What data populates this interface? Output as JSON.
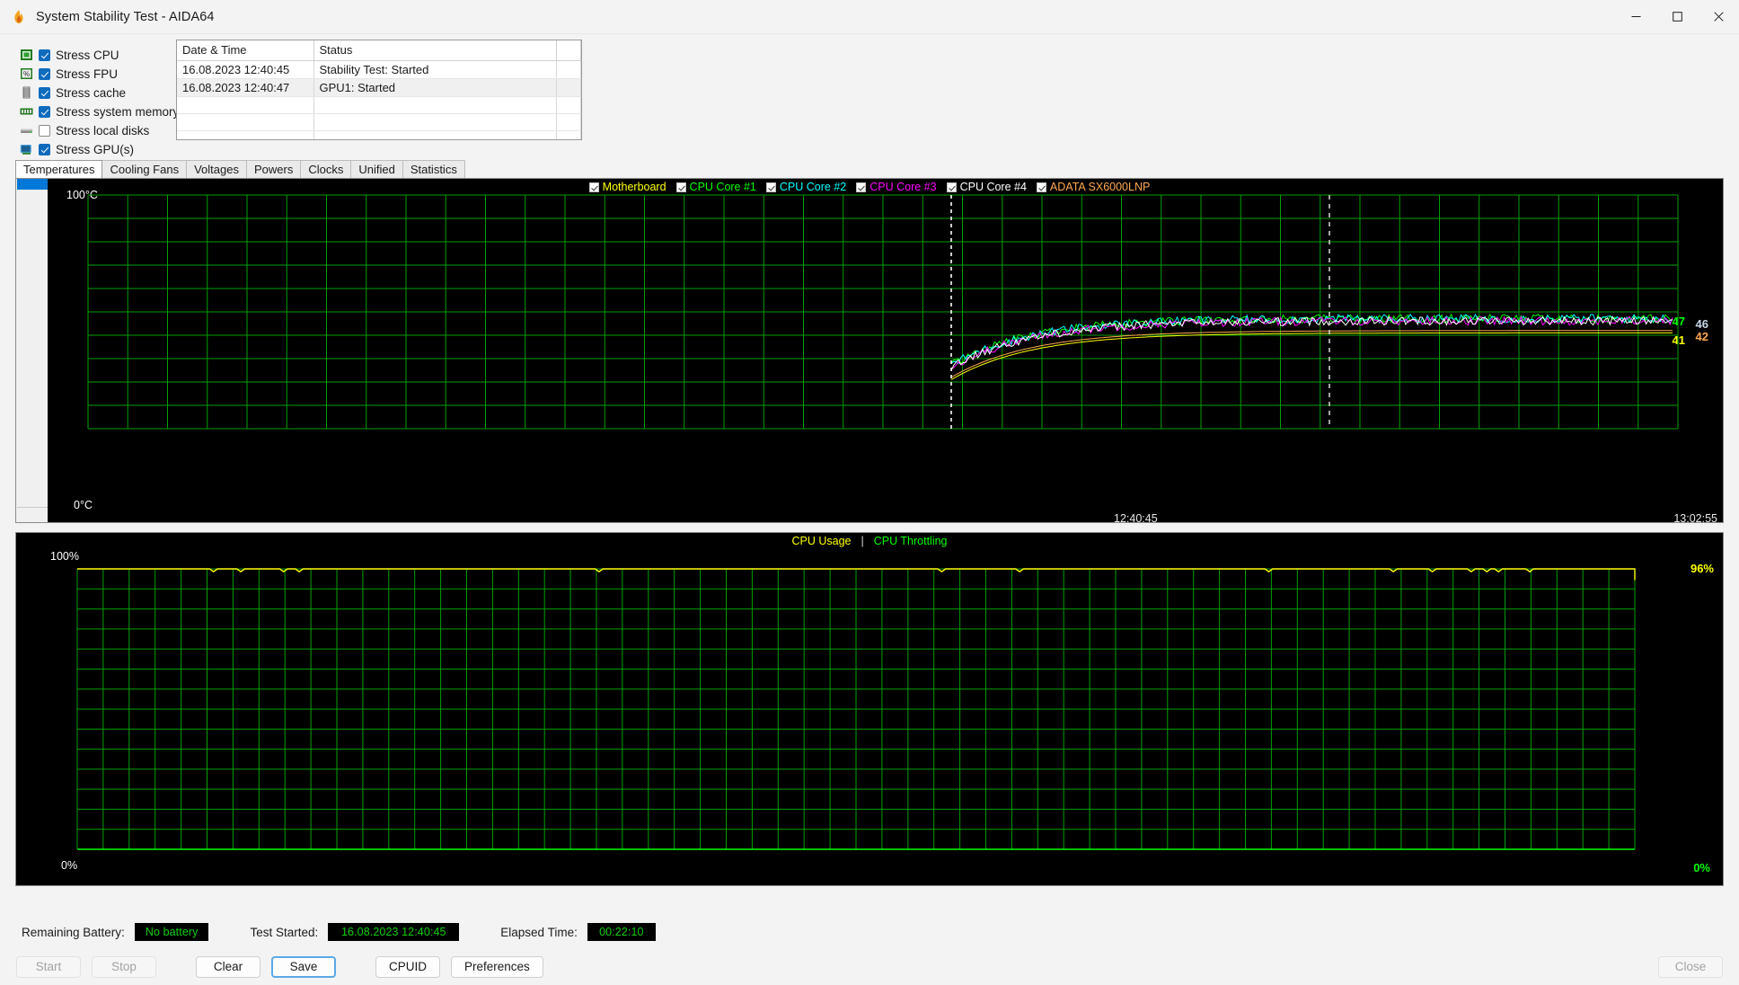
{
  "window": {
    "title": "System Stability Test - AIDA64",
    "icon": "aida64-flame-icon",
    "controls": {
      "minimize": "─",
      "maximize": "□",
      "close": "✕"
    }
  },
  "stress_options": [
    {
      "label": "Stress CPU",
      "checked": true,
      "icon": "cpu-chip-icon"
    },
    {
      "label": "Stress FPU",
      "checked": true,
      "icon": "fpu-percent-icon"
    },
    {
      "label": "Stress cache",
      "checked": true,
      "icon": "cache-icon"
    },
    {
      "label": "Stress system memory",
      "checked": true,
      "icon": "memory-module-icon"
    },
    {
      "label": "Stress local disks",
      "checked": false,
      "icon": "hard-disk-icon"
    },
    {
      "label": "Stress GPU(s)",
      "checked": true,
      "icon": "gpu-monitor-icon"
    }
  ],
  "log": {
    "columns": [
      "Date & Time",
      "Status"
    ],
    "rows": [
      {
        "datetime": "16.08.2023 12:40:45",
        "status": "Stability Test: Started"
      },
      {
        "datetime": "16.08.2023 12:40:47",
        "status": "GPU1: Started"
      }
    ]
  },
  "tabs": [
    {
      "label": "Temperatures",
      "active": true
    },
    {
      "label": "Cooling Fans",
      "active": false
    },
    {
      "label": "Voltages",
      "active": false
    },
    {
      "label": "Powers",
      "active": false
    },
    {
      "label": "Clocks",
      "active": false
    },
    {
      "label": "Unified",
      "active": false
    },
    {
      "label": "Statistics",
      "active": false
    }
  ],
  "chart_data": [
    {
      "type": "line",
      "name": "temperatures-chart",
      "title": "Temperatures",
      "ylabel_top": "100°C",
      "ylabel_bottom": "0°C",
      "ylim": [
        0,
        100
      ],
      "grid": true,
      "legend_position": "top-center",
      "xlabel_left": "12:40:45",
      "xlabel_right": "13:02:55",
      "marker_time": "12:40:45",
      "series": [
        {
          "name": "Motherboard",
          "color": "#ffff00",
          "checked": true,
          "current": 41,
          "label": "41"
        },
        {
          "name": "CPU Core #1",
          "color": "#00ff00",
          "checked": true,
          "current": 47,
          "label": "47"
        },
        {
          "name": "CPU Core #2",
          "color": "#00ffff",
          "checked": true,
          "current": 47,
          "label": ""
        },
        {
          "name": "CPU Core #3",
          "color": "#ff00ff",
          "checked": true,
          "current": 46,
          "label": ""
        },
        {
          "name": "CPU Core #4",
          "color": "#ffffff",
          "checked": true,
          "current": 46,
          "label": "46"
        },
        {
          "name": "ADATA SX6000LNP",
          "color": "#ffa850",
          "checked": true,
          "current": 42,
          "label": "42"
        }
      ]
    },
    {
      "type": "line",
      "name": "cpu-usage-chart",
      "title": "CPU Usage  |  CPU Throttling",
      "ylabel_top": "100%",
      "ylabel_bottom": "0%",
      "ylim": [
        0,
        100
      ],
      "grid": true,
      "legend_position": "top-center",
      "series": [
        {
          "name": "CPU Usage",
          "color": "#ffff00",
          "current": 96,
          "label": "96%"
        },
        {
          "name": "CPU Throttling",
          "color": "#00ff00",
          "current": 0,
          "label": "0%"
        }
      ]
    }
  ],
  "legend_separator": "|",
  "status": {
    "battery_label": "Remaining Battery:",
    "battery_value": "No battery",
    "started_label": "Test Started:",
    "started_value": "16.08.2023 12:40:45",
    "elapsed_label": "Elapsed Time:",
    "elapsed_value": "00:22:10"
  },
  "buttons": {
    "start": "Start",
    "stop": "Stop",
    "clear": "Clear",
    "save": "Save",
    "cpuid": "CPUID",
    "preferences": "Preferences",
    "close": "Close"
  }
}
